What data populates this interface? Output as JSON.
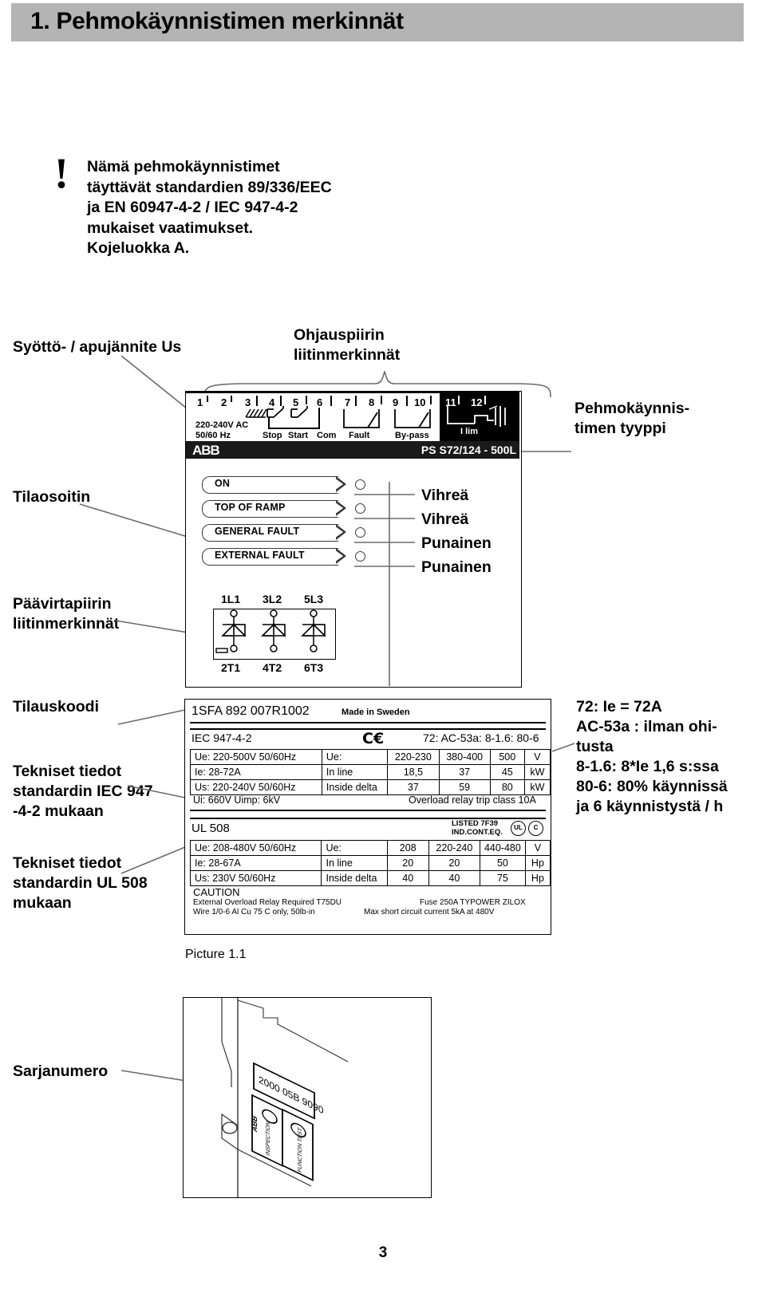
{
  "header": {
    "title": "1. Pehmokäynnistimen merkinnät"
  },
  "warning": {
    "icon": "exclamation-mark",
    "lines": [
      "Nämä pehmokäynnistimet",
      "täyttävät standardien 89/336/EEC",
      "ja EN 60947-4-2 / IEC 947-4-2",
      "mukaiset vaatimukset.",
      "Kojeluokka A."
    ]
  },
  "callouts": {
    "supply_voltage": "Syöttö- / apujännite Us",
    "control_terminals": "Ohjauspiirin\nliitinmerkinnät",
    "control_terminals_l1": "Ohjauspiirin",
    "control_terminals_l2": "liitinmerkinnät",
    "device_type_l1": "Pehmokäynnis-",
    "device_type_l2": "timen tyyppi",
    "status_indicator": "Tilaosoitin",
    "power_terminals_l1": "Päävirtapiirin",
    "power_terminals_l2": "liitinmerkinnät",
    "order_code": "Tilauskoodi",
    "iec_data_l1": "Tekniset tiedot",
    "iec_data_l2": "standardin IEC 947",
    "iec_data_l3": "-4-2 mukaan",
    "ul_data_l1": "Tekniset tiedot",
    "ul_data_l2": "standardin UL 508",
    "ul_data_l3": "mukaan",
    "serial_number": "Sarjanumero"
  },
  "terminal_strip": {
    "numbers": [
      "1",
      "2",
      "3",
      "4",
      "5",
      "6",
      "7",
      "8",
      "9",
      "10",
      "11",
      "12"
    ],
    "supply_l1": "220-240V AC",
    "supply_l2": "50/60 Hz",
    "functions": [
      "Stop",
      "Start",
      "Com",
      "Fault",
      "By-pass"
    ],
    "ilim_label": "I lim",
    "brand": "ABB",
    "device_type": "PS S72/124 - 500L"
  },
  "leds": [
    {
      "tag": "ON",
      "colour": "Vihreä"
    },
    {
      "tag": "TOP OF RAMP",
      "colour": "Vihreä"
    },
    {
      "tag": "GENERAL FAULT",
      "colour": "Punainen"
    },
    {
      "tag": "EXTERNAL FAULT",
      "colour": "Punainen"
    }
  ],
  "power_terminals": {
    "top": [
      "1L1",
      "3L2",
      "5L3"
    ],
    "bottom": [
      "2T1",
      "4T2",
      "6T3"
    ]
  },
  "rating_plate": {
    "order_code": "1SFA 892 007R1002",
    "made_in": "Made in Sweden",
    "iec_standard": "IEC 947-4-2",
    "ce_mark": "CE",
    "iec_rating_code": "72: AC-53a: 8-1.6: 80-6",
    "iec_rows": [
      {
        "left": "Ue: 220-500V 50/60Hz",
        "mid": "Ue:",
        "c1": "220-230",
        "c2": "380-400",
        "c3": "500",
        "unit": "V"
      },
      {
        "left": "Ie: 28-72A",
        "mid": "In line",
        "c1": "18,5",
        "c2": "37",
        "c3": "45",
        "unit": "kW"
      },
      {
        "left": "Us: 220-240V 50/60Hz",
        "mid": "Inside delta",
        "c1": "37",
        "c2": "59",
        "c3": "80",
        "unit": "kW"
      }
    ],
    "iec_footer_left": "Ui: 660V    Uimp: 6kV",
    "iec_footer_right": "Overload relay trip class 10A",
    "ul_standard": "UL 508",
    "ul_listed_l1": "LISTED 7F39",
    "ul_listed_l2": "IND.CONT.EQ.",
    "ul_mark_1": "UL",
    "ul_mark_2": "C",
    "ul_rows": [
      {
        "left": "Ue: 208-480V 50/60Hz",
        "mid": "Ue:",
        "c1": "208",
        "c2": "220-240",
        "c3": "440-480",
        "unit": "V"
      },
      {
        "left": "Ie: 28-67A",
        "mid": "In line",
        "c1": "20",
        "c2": "20",
        "c3": "50",
        "unit": "Hp"
      },
      {
        "left": "Us: 230V 50/60Hz",
        "mid": "Inside delta",
        "c1": "40",
        "c2": "40",
        "c3": "75",
        "unit": "Hp"
      }
    ],
    "caution_title": "CAUTION",
    "caution_l1": "External Overload Relay Required T75DU",
    "caution_l2": "Wire 1/0-6 Al Cu 75 C only, 50lb-in",
    "caution_r1": "Fuse 250A TYPOWER ZILOX",
    "caution_r2": "Max short circuit current 5kA at 480V"
  },
  "right_notes": {
    "l1": "72: Ie = 72A",
    "l2": "AC-53a : ilman ohi-",
    "l3": "tusta",
    "l4": "8-1.6: 8*Ie 1,6 s:ssa",
    "l5": "80-6: 80% käynnissä",
    "l6": "ja 6 käynnistystä / h"
  },
  "picture_caption": "Picture 1.1",
  "serial_plate": {
    "serial": "2000 05B 9090",
    "brand": "ABB",
    "label_1": "INSPECTION",
    "label_2": "FUNCTION TEST"
  },
  "page_number": "3"
}
